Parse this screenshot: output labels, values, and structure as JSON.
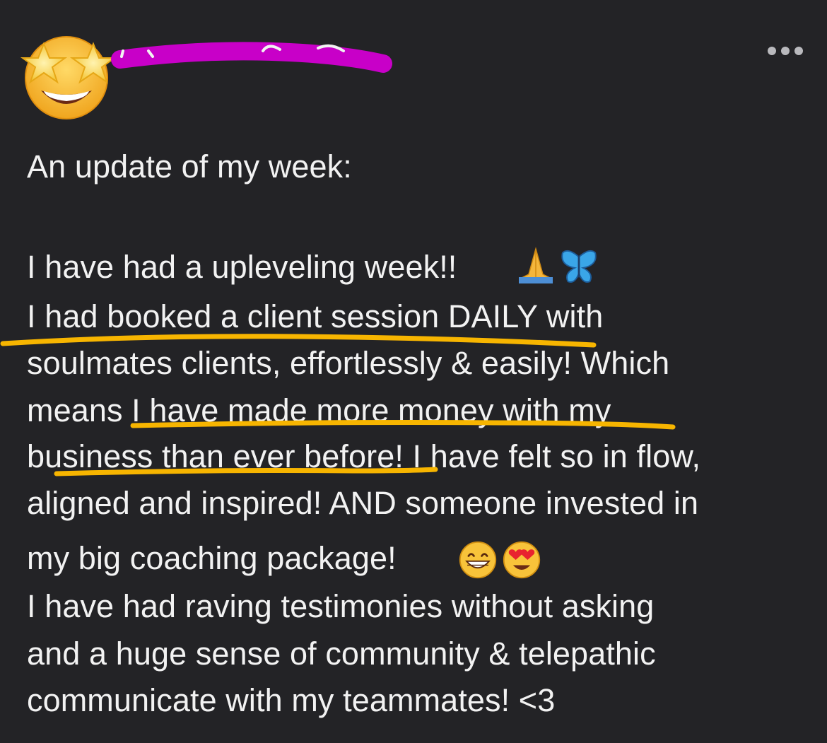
{
  "post": {
    "author_name": "",
    "menu_icon": "more-horizontal-icon",
    "avatar_icon": "star-struck-emoji-icon",
    "lines": [
      "An update of my week:",
      "I have had a upleveling week!!",
      "I had booked a client session DAILY with",
      "soulmates clients, effortlessly & easily! Which",
      "means I have made more money with my",
      "business than ever before! I have felt so in flow,",
      "aligned and inspired! AND someone invested in",
      "my big coaching package!",
      "I have had raving testimonies without asking",
      "and a huge sense of community & telepathic",
      "communicate with my teammates! <3"
    ],
    "line_emojis": {
      "upleveling": [
        "folded-hands-icon",
        "butterfly-icon"
      ],
      "coaching": [
        "grinning-face-icon",
        "heart-eyes-face-icon"
      ]
    }
  },
  "colors": {
    "background": "#232326",
    "text": "#f2f2f2",
    "highlight_underline": "#f7b500",
    "redaction_scribble": "#c800c8"
  }
}
